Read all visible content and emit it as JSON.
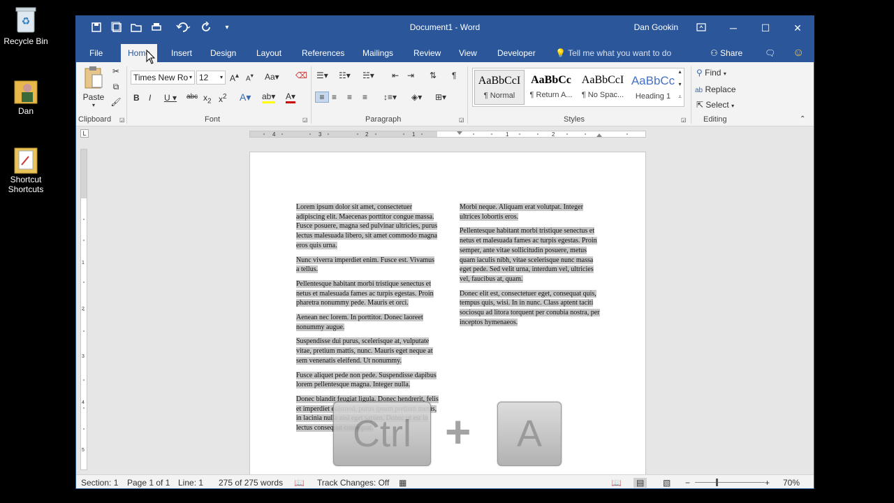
{
  "desktop": {
    "icons": [
      {
        "label": "Recycle Bin"
      },
      {
        "label": "Dan"
      },
      {
        "label": "Shortcut Shortcuts"
      }
    ]
  },
  "titlebar": {
    "document_title": "Document1 - Word",
    "user": "Dan Gookin"
  },
  "tabs": [
    "File",
    "Home",
    "Insert",
    "Design",
    "Layout",
    "References",
    "Mailings",
    "Review",
    "View",
    "Developer"
  ],
  "tell_me": "Tell me what you want to do",
  "share": "Share",
  "ribbon": {
    "clipboard": {
      "paste": "Paste",
      "label": "Clipboard"
    },
    "font": {
      "name": "Times New Ro",
      "size": "12",
      "label": "Font"
    },
    "paragraph": {
      "label": "Paragraph"
    },
    "styles": {
      "label": "Styles",
      "items": [
        {
          "sample": "AaBbCcI",
          "name": "¶ Normal"
        },
        {
          "sample": "AaBbCc",
          "name": "¶ Return A..."
        },
        {
          "sample": "AaBbCcI",
          "name": "¶ No Spac..."
        },
        {
          "sample": "AaBbCc",
          "name": "Heading 1"
        }
      ]
    },
    "editing": {
      "find": "Find",
      "replace": "Replace",
      "select": "Select",
      "label": "Editing"
    }
  },
  "document": {
    "left_column": [
      "Lorem ipsum dolor sit amet, consectetuer adipiscing elit. Maecenas porttitor congue massa. Fusce posuere, magna sed pulvinar ultricies, purus lectus malesuada libero, sit amet commodo magna eros quis urna.",
      "Nunc viverra imperdiet enim. Fusce est. Vivamus a tellus.",
      "Pellentesque habitant morbi tristique senectus et netus et malesuada fames ac turpis egestas. Proin pharetra nonummy pede. Mauris et orci.",
      "Aenean nec lorem. In porttitor. Donec laoreet nonummy augue.",
      "Suspendisse dui purus, scelerisque at, vulputate vitae, pretium mattis, nunc. Mauris eget neque at sem venenatis eleifend. Ut nonummy.",
      "Fusce aliquet pede non pede. Suspendisse dapibus lorem pellentesque magna. Integer nulla.",
      "Donec blandit feugiat ligula. Donec hendrerit, felis et imperdiet euismod, purus ipsum pretium metus, in lacinia nulla nisl eget sapien. Donec ut est in lectus consequat consequat."
    ],
    "right_column": [
      "Morbi neque. Aliquam erat volutpat. Integer ultrices lobortis eros.",
      "Pellentesque habitant morbi tristique senectus et netus et malesuada fames ac turpis egestas. Proin semper, ante vitae sollicitudin posuere, metus quam iaculis nibh, vitae scelerisque nunc massa eget pede. Sed velit urna, interdum vel, ultricies vel, faucibus at, quam.",
      "Donec elit est, consectetuer eget, consequat quis, tempus quis, wisi. In in nunc. Class aptent taciti sociosqu ad litora torquent per conubia nostra, per inceptos hymenaeos."
    ]
  },
  "overlay": {
    "key1": "Ctrl",
    "plus": "+",
    "key2": "A"
  },
  "statusbar": {
    "section": "Section: 1",
    "page": "Page 1 of 1",
    "line": "Line: 1",
    "words": "275 of 275 words",
    "track": "Track Changes: Off",
    "zoom": "70%"
  },
  "colors": {
    "accent": "#2b579a",
    "selection": "#c8c8c8"
  }
}
